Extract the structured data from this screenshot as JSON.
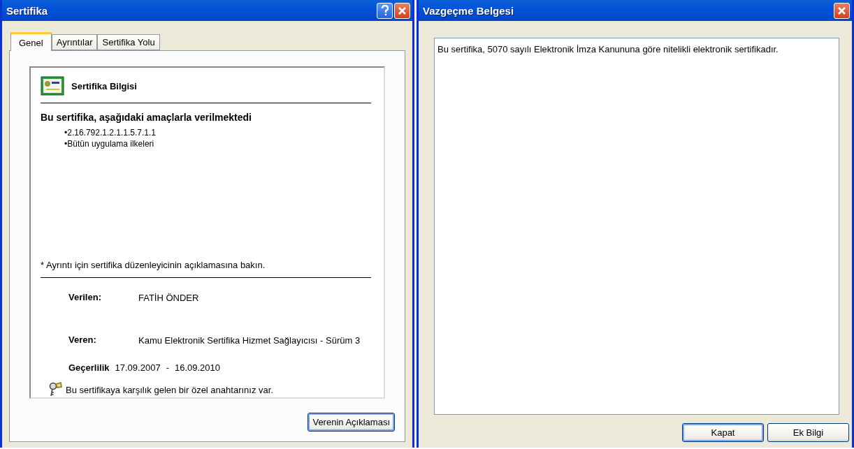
{
  "certificate_window": {
    "title": "Sertifika",
    "tabs": [
      {
        "label": "Genel",
        "selected": true
      },
      {
        "label": "Ayrıntılar",
        "selected": false
      },
      {
        "label": "Sertifika Yolu",
        "selected": false
      }
    ],
    "info_title": "Sertifika Bilgisi",
    "purpose_heading": "Bu sertifika, aşağıdaki amaçlarla verilmektedi",
    "purposes": [
      "•2.16.792.1.2.1.1.5.7.1.1",
      "•Bütün uygulama ilkeleri"
    ],
    "note": "* Ayrıntı için sertifika düzenleyicinin açıklamasına bakın.",
    "issued_to_label": "Verilen:",
    "issued_to": "FATİH ÖNDER",
    "issued_by_label": "Veren:",
    "issued_by": "Kamu Elektronik Sertifika Hizmet Sağlayıcısı - Sürüm 3",
    "validity_label": "Geçerlilik",
    "valid_from": "17.09.2007",
    "valid_sep": "-",
    "valid_to": "16.09.2010",
    "private_key_note": "Bu sertifikaya karşılık gelen bir özel anahtarınız var.",
    "button": "Verenin Açıklaması"
  },
  "disclaimer_window": {
    "title": "Vazgeçme Belgesi",
    "text": "Bu sertifika, 5070 sayılı Elektronik İmza Kanununa göre nitelikli elektronik sertifikadır.",
    "buttons": [
      {
        "label": "Kapat",
        "default": true
      },
      {
        "label": "Ek Bilgi",
        "default": false
      }
    ]
  }
}
